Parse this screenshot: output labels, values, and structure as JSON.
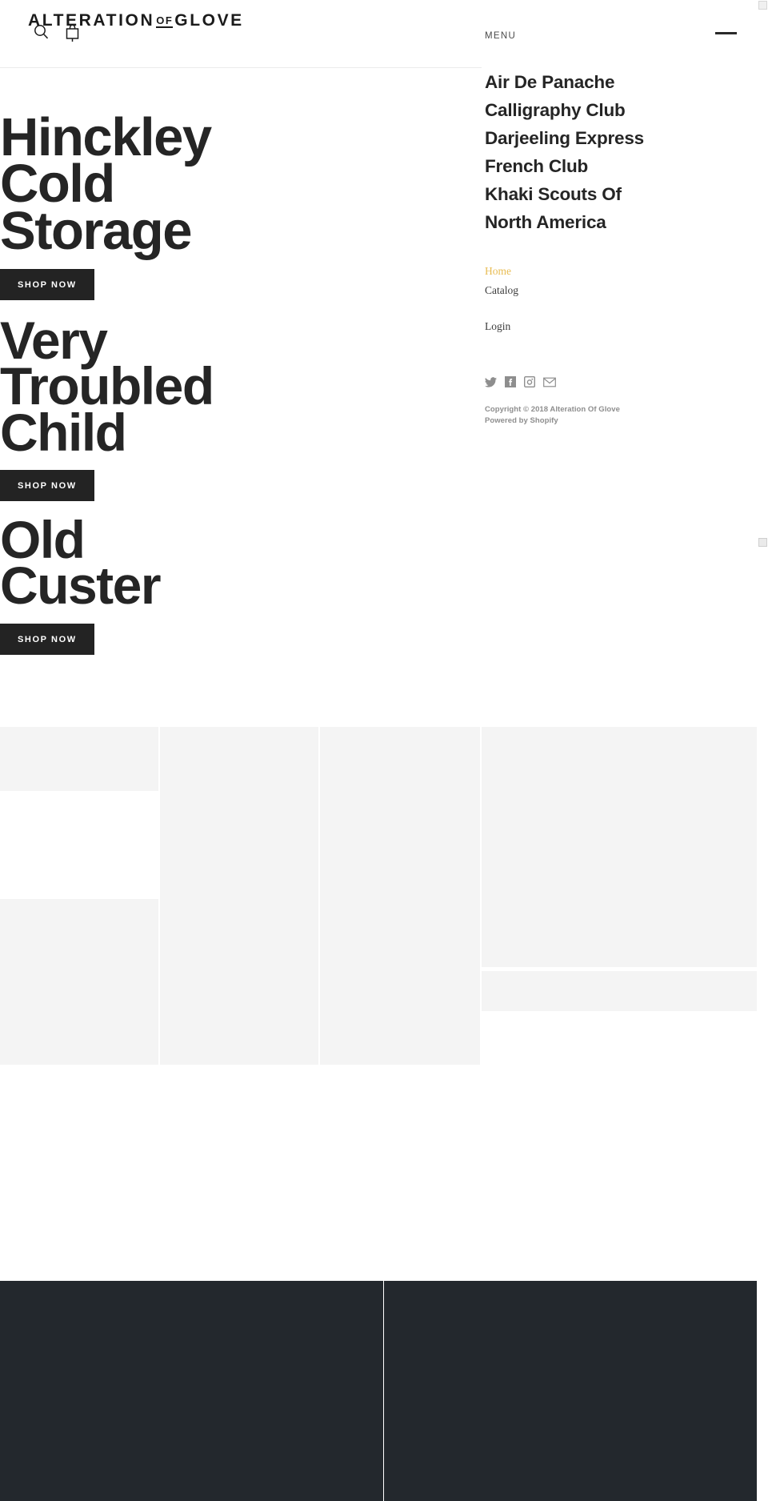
{
  "site": {
    "logo_main_1": "ALTERATION",
    "logo_of": "OF",
    "logo_main_2": "GLOVE"
  },
  "header": {
    "search_icon": "search-icon",
    "cart_icon": "shopping-bag-icon"
  },
  "hero": {
    "slides": [
      {
        "title": "Hinckley\nCold\nStorage",
        "cta": "SHOP NOW"
      },
      {
        "title": "Very\nTroubled\nChild",
        "cta": "SHOP NOW"
      },
      {
        "title": "Old\nCuster",
        "cta": "SHOP NOW"
      }
    ]
  },
  "drawer": {
    "label": "MENU",
    "close_icon": "close-bar-icon",
    "main_links": [
      {
        "label": "Air De Panache"
      },
      {
        "label": "Calligraphy Club"
      },
      {
        "label": "Darjeeling Express"
      },
      {
        "label": "French Club"
      },
      {
        "label": "Khaki Scouts Of\nNorth America"
      }
    ],
    "sub_links": [
      {
        "label": "Home",
        "active": true
      },
      {
        "label": "Catalog",
        "active": false
      },
      {
        "label": "Login",
        "active": false
      }
    ],
    "social": [
      {
        "name": "twitter-icon"
      },
      {
        "name": "facebook-icon"
      },
      {
        "name": "instagram-icon"
      },
      {
        "name": "email-icon"
      }
    ],
    "legal": {
      "copyright": "Copyright © 2018 Alteration Of Glove",
      "powered": "Powered by Shopify"
    }
  },
  "colors": {
    "accent_gold": "#e8bc52",
    "text_dark": "#252525",
    "button_bg": "#232323",
    "footer_dark": "#23282d",
    "placeholder_grey": "#f4f4f4",
    "social_grey": "#8e8e8e"
  }
}
